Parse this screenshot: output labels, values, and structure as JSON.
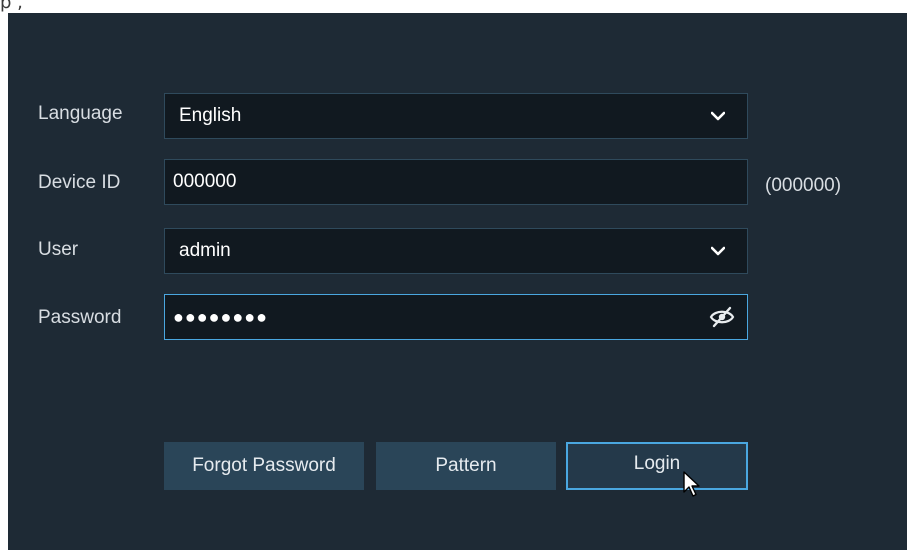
{
  "top_text": "p          ,",
  "form": {
    "language": {
      "label": "Language",
      "value": "English"
    },
    "device_id": {
      "label": "Device ID",
      "value": "000000",
      "hint": "(000000)"
    },
    "user": {
      "label": "User",
      "value": "admin"
    },
    "password": {
      "label": "Password",
      "value": "●●●●●●●●"
    }
  },
  "buttons": {
    "forgot": "Forgot Password",
    "pattern": "Pattern",
    "login": "Login"
  },
  "icons": {
    "dropdown": "chevron-down-icon",
    "password_toggle": "eye-off-icon",
    "cursor": "mouse-pointer-icon"
  },
  "colors": {
    "panel_bg": "#1e2a35",
    "field_bg": "#111920",
    "accent": "#4aa7e0",
    "button_bg": "#2a4558"
  }
}
